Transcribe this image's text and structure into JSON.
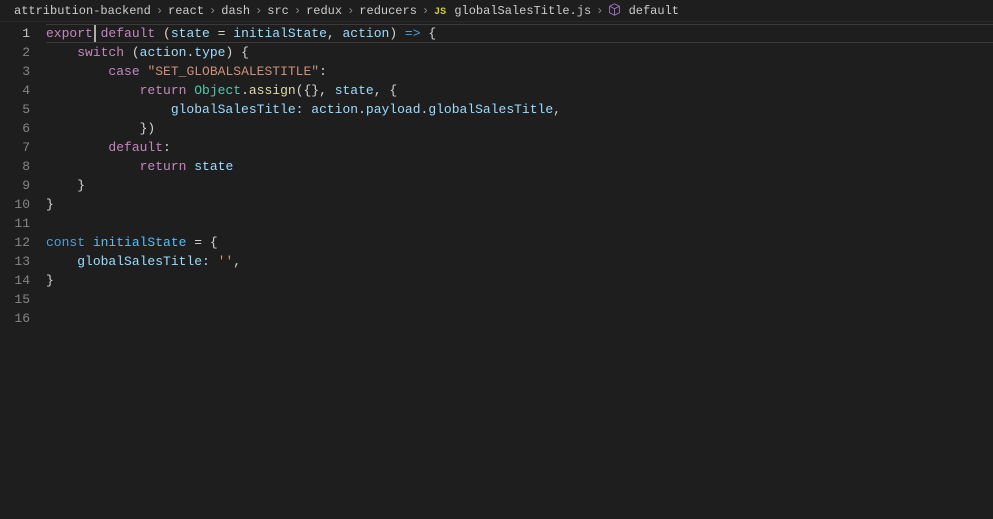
{
  "breadcrumb": {
    "items": [
      {
        "label": "attribution-backend"
      },
      {
        "label": "react"
      },
      {
        "label": "dash"
      },
      {
        "label": "src"
      },
      {
        "label": "redux"
      },
      {
        "label": "reducers"
      },
      {
        "label": "globalSalesTitle.js",
        "icon": "js"
      },
      {
        "label": "default",
        "icon": "cube"
      }
    ],
    "separator": "›"
  },
  "lineNumbers": [
    "1",
    "2",
    "3",
    "4",
    "5",
    "6",
    "7",
    "8",
    "9",
    "10",
    "11",
    "12",
    "13",
    "14",
    "15",
    "16"
  ],
  "activeLine": 1,
  "code": {
    "l1": {
      "t0": "export",
      "t1": " ",
      "t2": "default",
      "t3": " (",
      "t4": "state",
      "t5": " = ",
      "t6": "initialState",
      "t7": ", ",
      "t8": "action",
      "t9": ") ",
      "t10": "=>",
      "t11": " {"
    },
    "l2": {
      "i": "    ",
      "t0": "switch",
      "t1": " (",
      "t2": "action",
      "t3": ".",
      "t4": "type",
      "t5": ") {"
    },
    "l3": {
      "i": "        ",
      "t0": "case",
      "t1": " ",
      "t2": "\"SET_GLOBALSALESTITLE\"",
      "t3": ":"
    },
    "l4": {
      "i": "            ",
      "t0": "return",
      "t1": " ",
      "t2": "Object",
      "t3": ".",
      "t4": "assign",
      "t5": "({}, ",
      "t6": "state",
      "t7": ", {"
    },
    "l5": {
      "i": "                ",
      "t0": "globalSalesTitle:",
      "t1": " ",
      "t2": "action",
      "t3": ".",
      "t4": "payload",
      "t5": ".",
      "t6": "globalSalesTitle",
      "t7": ","
    },
    "l6": {
      "i": "            ",
      "t0": "})"
    },
    "l7": {
      "i": "        ",
      "t0": "default",
      "t1": ":"
    },
    "l8": {
      "i": "            ",
      "t0": "return",
      "t1": " ",
      "t2": "state"
    },
    "l9": {
      "i": "    ",
      "t0": "}"
    },
    "l10": {
      "t0": "}"
    },
    "l11": {
      "t0": ""
    },
    "l12": {
      "t0": "const",
      "t1": " ",
      "t2": "initialState",
      "t3": " = {"
    },
    "l13": {
      "i": "    ",
      "t0": "globalSalesTitle:",
      "t1": " ",
      "t2": "''",
      "t3": ","
    },
    "l14": {
      "t0": "}"
    },
    "l15": {
      "t0": ""
    },
    "l16": {
      "t0": ""
    }
  }
}
